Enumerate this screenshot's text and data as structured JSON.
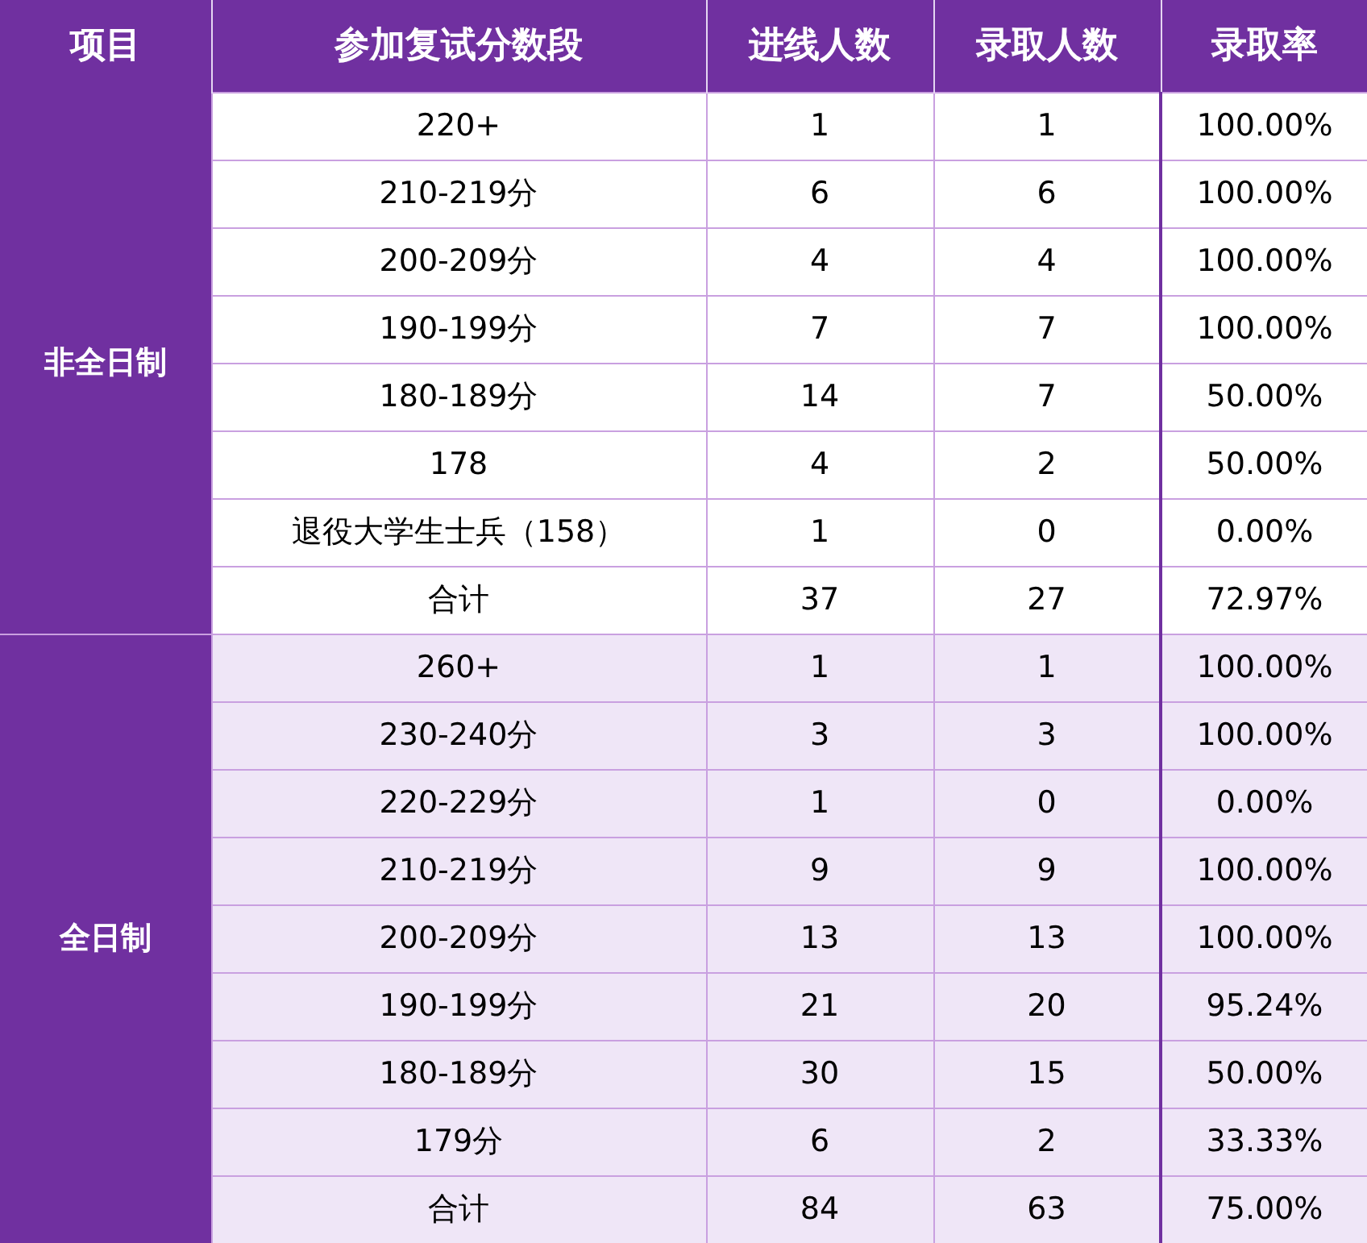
{
  "table": {
    "columns": [
      "项目",
      "参加复试分数段",
      "进线人数",
      "录取人数",
      "录取率"
    ],
    "groups": [
      {
        "name": "非全日制",
        "shaded": false,
        "rows": [
          [
            "220+",
            "1",
            "1",
            "100.00%"
          ],
          [
            "210-219分",
            "6",
            "6",
            "100.00%"
          ],
          [
            "200-209分",
            "4",
            "4",
            "100.00%"
          ],
          [
            "190-199分",
            "7",
            "7",
            "100.00%"
          ],
          [
            "180-189分",
            "14",
            "7",
            "50.00%"
          ],
          [
            "178",
            "4",
            "2",
            "50.00%"
          ],
          [
            "退役大学生士兵（158）",
            "1",
            "0",
            "0.00%"
          ],
          [
            "合计",
            "37",
            "27",
            "72.97%"
          ]
        ]
      },
      {
        "name": "全日制",
        "shaded": true,
        "rows": [
          [
            "260+",
            "1",
            "1",
            "100.00%"
          ],
          [
            "230-240分",
            "3",
            "3",
            "100.00%"
          ],
          [
            "220-229分",
            "1",
            "0",
            "0.00%"
          ],
          [
            "210-219分",
            "9",
            "9",
            "100.00%"
          ],
          [
            "200-209分",
            "13",
            "13",
            "100.00%"
          ],
          [
            "190-199分",
            "21",
            "20",
            "95.24%"
          ],
          [
            "180-189分",
            "30",
            "15",
            "50.00%"
          ],
          [
            "179分",
            "6",
            "2",
            "33.33%"
          ],
          [
            "合计",
            "84",
            "63",
            "75.00%"
          ]
        ]
      }
    ]
  }
}
